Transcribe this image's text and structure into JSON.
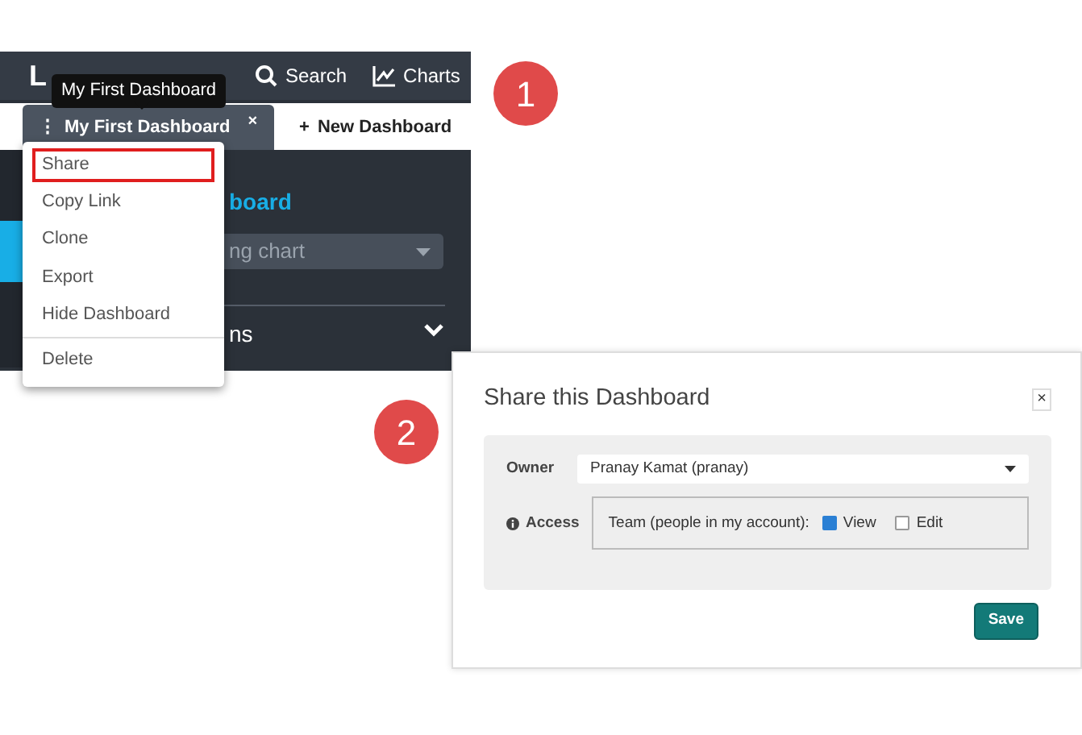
{
  "app": {
    "logo": "L",
    "nav": [
      {
        "label": "Search",
        "kind": "search"
      },
      {
        "label": "Charts",
        "kind": "charts"
      }
    ],
    "tooltip": "My First Dashboard",
    "tabs": [
      {
        "label": "My First Dashboard",
        "menu_icon": "⋮",
        "close": "×",
        "selected": true
      },
      {
        "label": "New Dashboard",
        "add_icon": "+",
        "selected": false
      }
    ],
    "menu": [
      {
        "label": "Share",
        "highlighted": true
      },
      {
        "label": "Copy Link",
        "highlighted": false
      },
      {
        "label": "Clone",
        "highlighted": false
      },
      {
        "label": "Export",
        "highlighted": false
      },
      {
        "label": "Hide Dashboard",
        "highlighted": false
      },
      {
        "label": "Delete",
        "highlighted": false,
        "divider_before": true
      }
    ],
    "heading": "board",
    "chart_select": "ng chart",
    "section": "ns"
  },
  "steps": [
    {
      "label": "1"
    },
    {
      "label": "2"
    }
  ],
  "dialog": {
    "title": "Share this Dashboard",
    "close": "×",
    "owner": {
      "label": "Owner",
      "value": "Pranay Kamat (pranay)"
    },
    "access": {
      "label": "Access",
      "group": "Team (people in my account):",
      "options": [
        {
          "label": "View",
          "checked": true
        },
        {
          "label": "Edit",
          "checked": false
        }
      ]
    },
    "save": "Save"
  }
}
